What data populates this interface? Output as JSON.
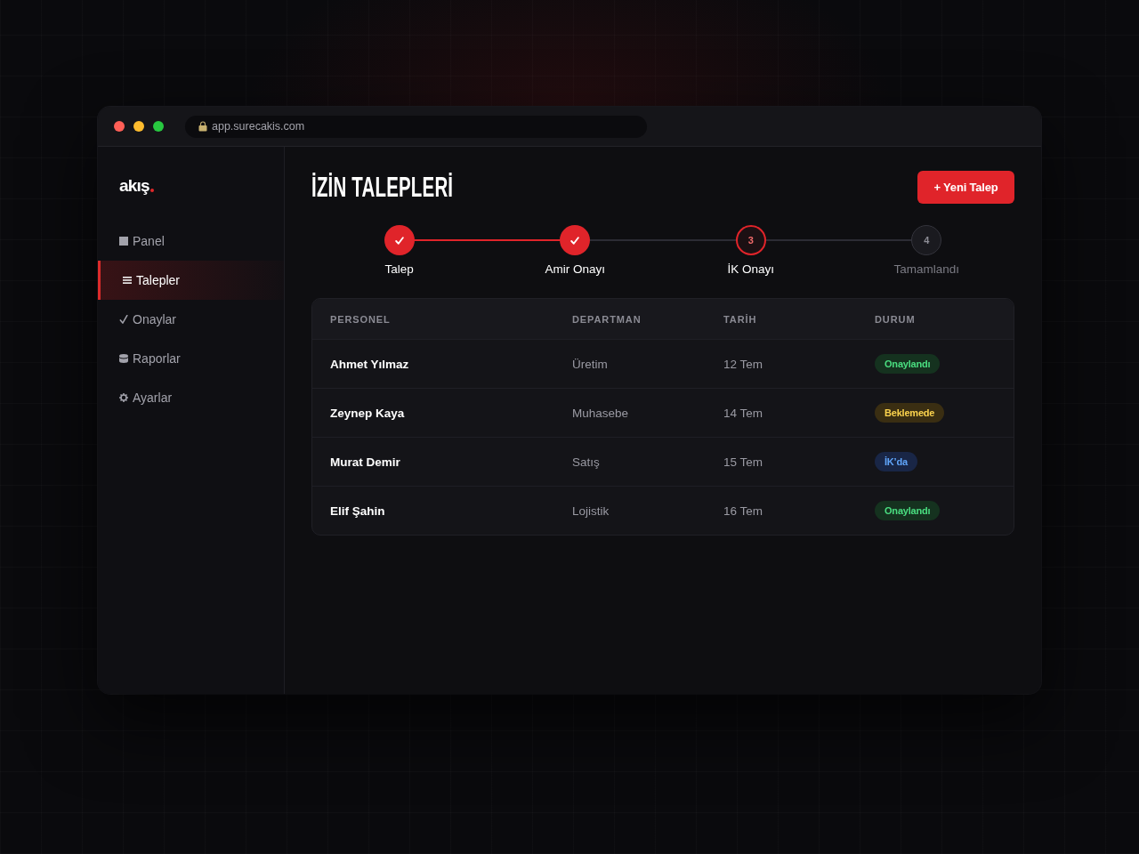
{
  "browser": {
    "url": "app.surecakis.com"
  },
  "sidebar": {
    "logo": "akış",
    "items": [
      {
        "label": "Panel",
        "selected": false
      },
      {
        "label": "Talepler",
        "selected": true
      },
      {
        "label": "Onaylar",
        "selected": false
      },
      {
        "label": "Raporlar",
        "selected": false
      },
      {
        "label": "Ayarlar",
        "selected": false
      }
    ]
  },
  "header": {
    "title": "İZİN TALEPLERİ",
    "new_button": "+ Yeni Talep"
  },
  "stepper": {
    "steps": [
      {
        "label": "Talep",
        "completed": true,
        "selected": false
      },
      {
        "label": "Amir Onayı",
        "completed": true,
        "selected": false
      },
      {
        "label": "İK Onayı",
        "number": "3",
        "completed": false,
        "selected": true
      },
      {
        "label": "Tamamlandı",
        "number": "4",
        "completed": false,
        "selected": false
      }
    ]
  },
  "table": {
    "columns": [
      "PERSONEL",
      "DEPARTMAN",
      "TARİH",
      "DURUM"
    ],
    "rows": [
      {
        "name": "Ahmet Yılmaz",
        "department": "Üretim",
        "date": "12 Tem",
        "status": {
          "label": "Onaylandı",
          "kind": "approved"
        }
      },
      {
        "name": "Zeynep Kaya",
        "department": "Muhasebe",
        "date": "14 Tem",
        "status": {
          "label": "Beklemede",
          "kind": "pending"
        }
      },
      {
        "name": "Murat Demir",
        "department": "Satış",
        "date": "15 Tem",
        "status": {
          "label": "İK’da",
          "kind": "in_review"
        }
      },
      {
        "name": "Elif Şahin",
        "department": "Lojistik",
        "date": "16 Tem",
        "status": {
          "label": "Onaylandı",
          "kind": "approved"
        }
      }
    ]
  }
}
